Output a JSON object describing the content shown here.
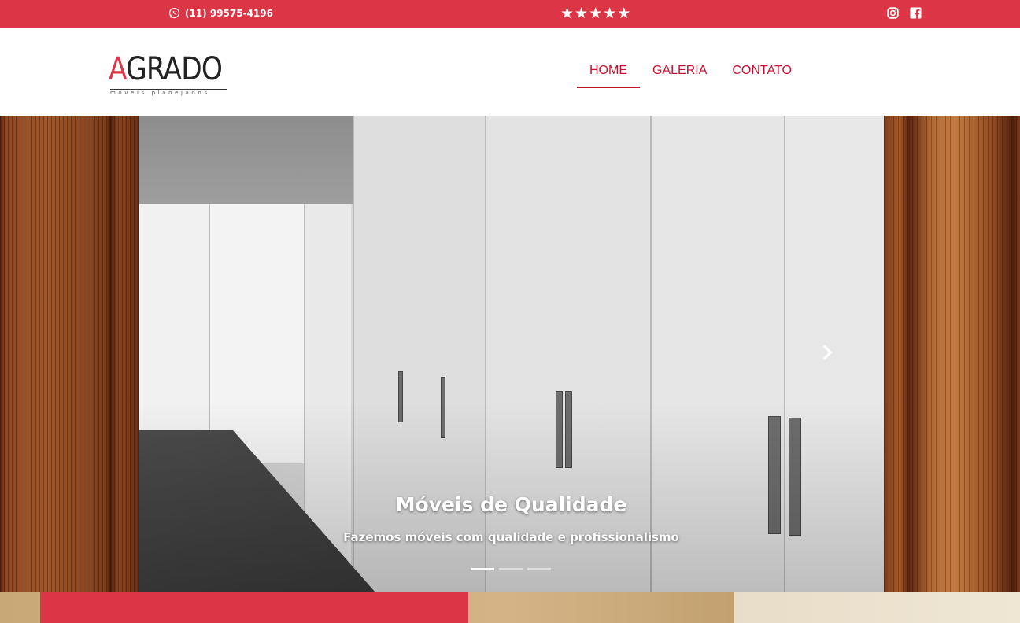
{
  "topbar": {
    "phone": "(11) 99575-4196",
    "stars": [
      "★",
      "★",
      "★",
      "★",
      "★"
    ],
    "social_icons": [
      "instagram-icon",
      "facebook-icon"
    ],
    "background_color": "#dc3545"
  },
  "header": {
    "logo_word": "GRADO",
    "logo_initial": "A",
    "logo_tagline": "móveis planejados",
    "nav": [
      {
        "label": "HOME",
        "active": true
      },
      {
        "label": "GALERIA",
        "active": false
      },
      {
        "label": "CONTATO",
        "active": false
      }
    ],
    "accent_color": "#c8102e"
  },
  "hero": {
    "title": "Móveis de Qualidade",
    "subtitle": "Fazemos móveis com qualidade e profissionalismo",
    "indicators": [
      true,
      false,
      false
    ],
    "next_icon": "chevron-right-icon"
  }
}
